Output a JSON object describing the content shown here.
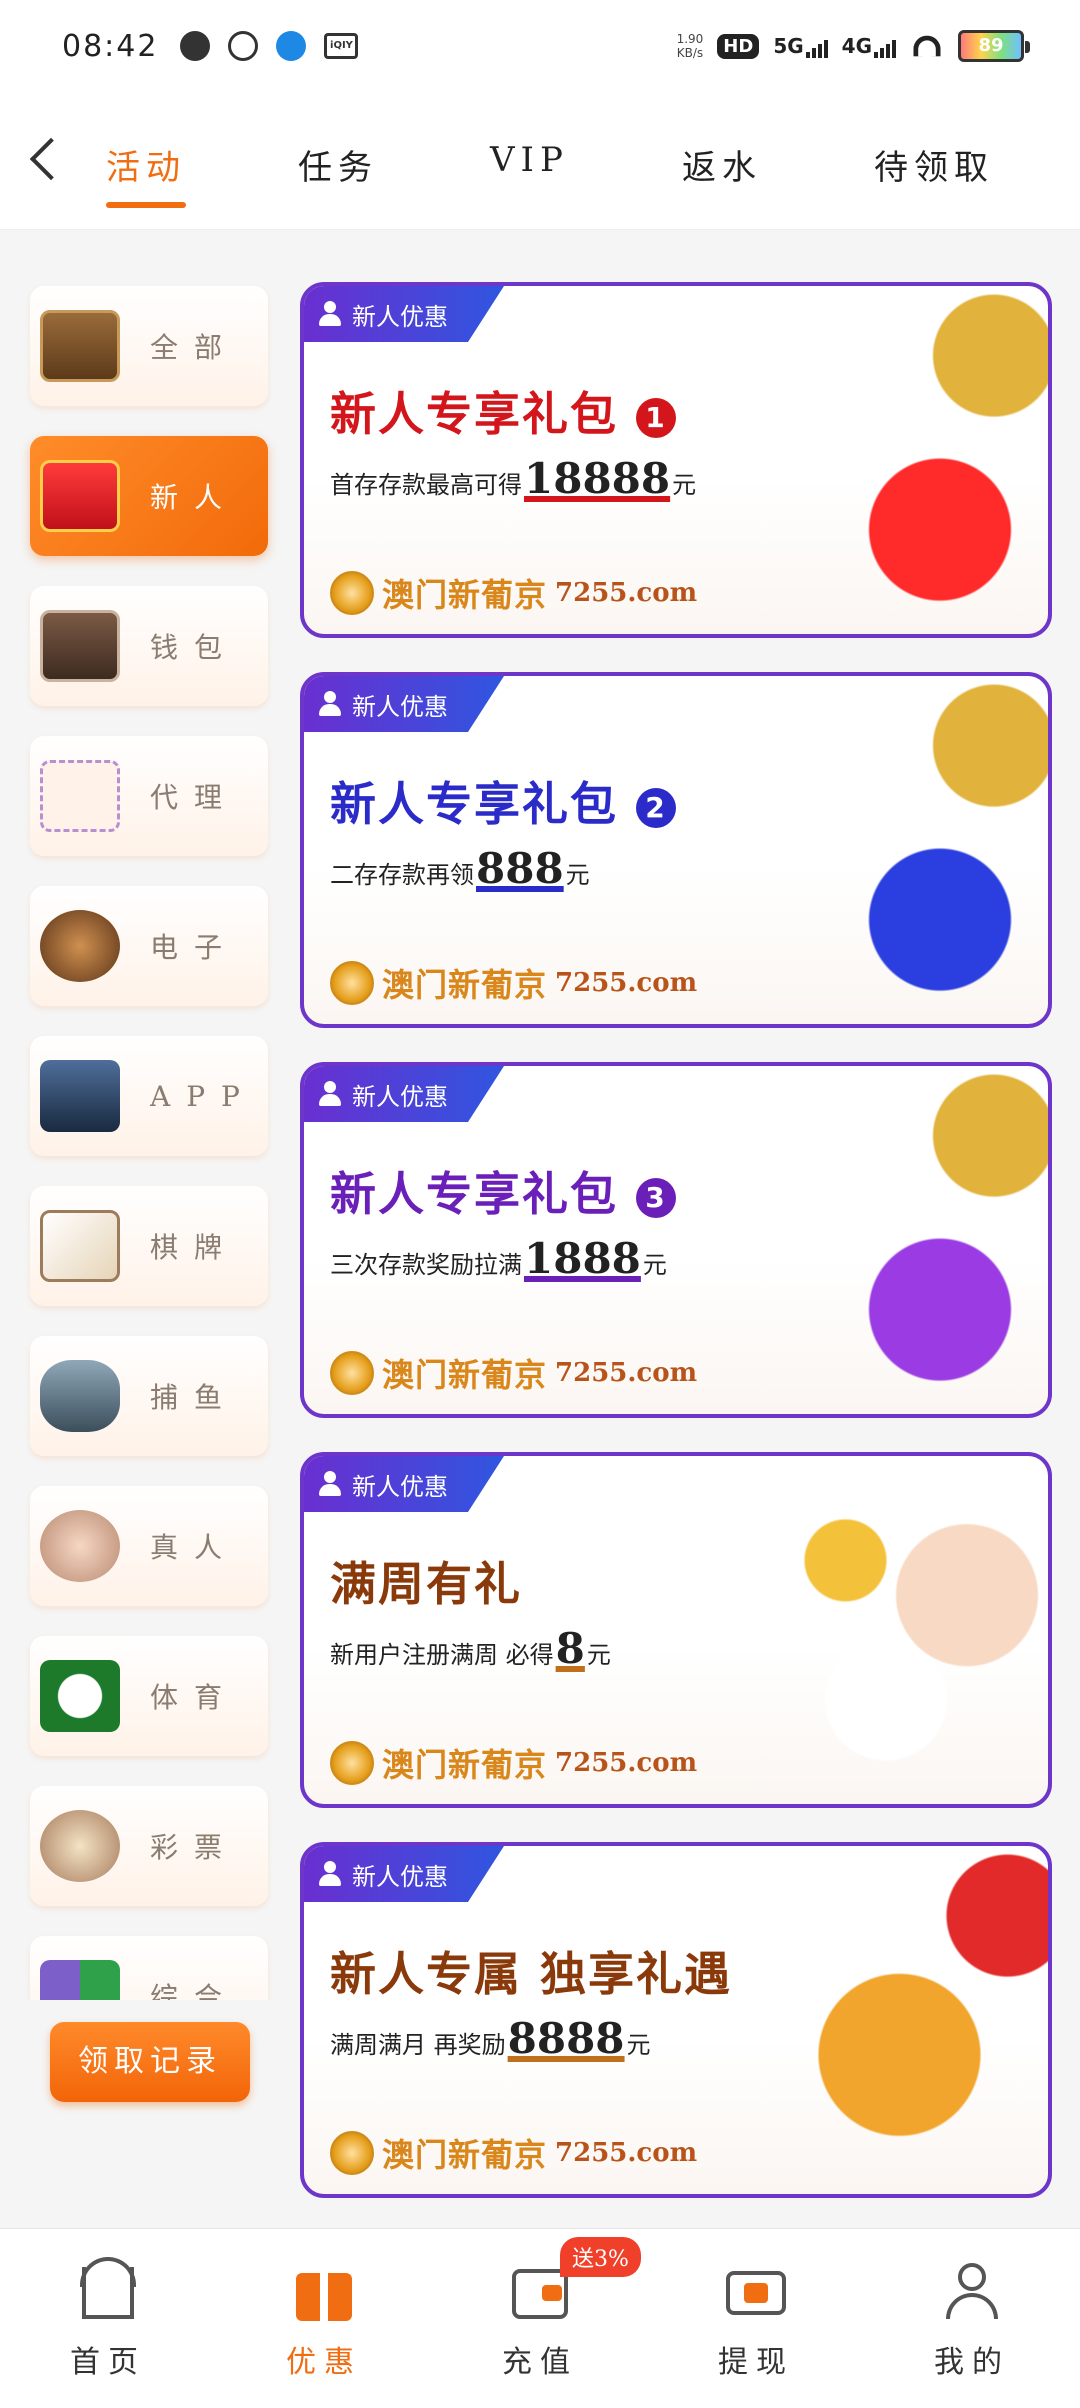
{
  "status_bar": {
    "time": "08:42",
    "speed": "1.90",
    "speed_unit": "KB/s",
    "hd": "HD",
    "net1": "5G",
    "net2": "4G",
    "battery": "89"
  },
  "tabs": [
    {
      "label": "活动",
      "active": true
    },
    {
      "label": "任务"
    },
    {
      "label": "VIP"
    },
    {
      "label": "返水"
    },
    {
      "label": "待领取"
    }
  ],
  "categories": [
    {
      "label": "全部",
      "icon": "treasure-chest-icon",
      "active": false
    },
    {
      "label": "新人",
      "icon": "gift-icon",
      "active": true
    },
    {
      "label": "钱包",
      "icon": "wallet-icon",
      "active": false
    },
    {
      "label": "代理",
      "icon": "agent-network-icon",
      "active": false
    },
    {
      "label": "电子",
      "icon": "slot-machine-icon",
      "active": false
    },
    {
      "label": "APP",
      "icon": "phone-app-icon",
      "active": false
    },
    {
      "label": "棋牌",
      "icon": "playing-cards-icon",
      "active": false
    },
    {
      "label": "捕鱼",
      "icon": "fish-icon",
      "active": false
    },
    {
      "label": "真人",
      "icon": "live-dealer-icon",
      "active": false
    },
    {
      "label": "体育",
      "icon": "soccer-ball-icon",
      "active": false
    },
    {
      "label": "彩票",
      "icon": "lottery-balls-icon",
      "active": false
    },
    {
      "label": "综合",
      "icon": "mixed-icon",
      "active": false
    }
  ],
  "claim_record_button": "领取记录",
  "promos": [
    {
      "tag": "新人优惠",
      "title": "新人专享礼包",
      "num_badge": "1",
      "sub_prefix": "首存存款最高可得",
      "amount": "18888",
      "sub_suffix": "元",
      "brand": "澳门新葡京",
      "url": "7255.com",
      "title_color": "#d3161c",
      "accent": "#d3161c"
    },
    {
      "tag": "新人优惠",
      "title": "新人专享礼包",
      "num_badge": "2",
      "sub_prefix": "二存存款再领",
      "amount": "888",
      "sub_suffix": "元",
      "brand": "澳门新葡京",
      "url": "7255.com",
      "title_color": "#2b2bc9",
      "accent": "#2b2bc9"
    },
    {
      "tag": "新人优惠",
      "title": "新人专享礼包",
      "num_badge": "3",
      "sub_prefix": "三次存款奖励拉满",
      "amount": "1888",
      "sub_suffix": "元",
      "brand": "澳门新葡京",
      "url": "7255.com",
      "title_color": "#6a1fb8",
      "accent": "#6a1fb8"
    },
    {
      "tag": "新人优惠",
      "title": "满周有礼",
      "num_badge": "",
      "sub_prefix": "新用户注册满周 必得",
      "amount": "8",
      "sub_suffix": "元",
      "brand": "澳门新葡京",
      "url": "7255.com",
      "title_color": "#8a3a0a",
      "accent": "#c0701a"
    },
    {
      "tag": "新人优惠",
      "title": "新人专属 独享礼遇",
      "num_badge": "",
      "sub_prefix": "满周满月 再奖励",
      "amount": "8888",
      "sub_suffix": "元",
      "brand": "澳门新葡京",
      "url": "7255.com",
      "title_color": "#8a3a0a",
      "accent": "#c0701a"
    }
  ],
  "bottom_nav": [
    {
      "label": "首页",
      "icon": "home-icon",
      "active": false
    },
    {
      "label": "优惠",
      "icon": "gift-box-icon",
      "active": true
    },
    {
      "label": "充值",
      "icon": "deposit-wallet-icon",
      "active": false,
      "badge": "送3%"
    },
    {
      "label": "提现",
      "icon": "withdraw-ticket-icon",
      "active": false
    },
    {
      "label": "我的",
      "icon": "profile-icon",
      "active": false
    }
  ],
  "colors": {
    "accent": "#f06d12",
    "frame": "#6d35c9"
  }
}
